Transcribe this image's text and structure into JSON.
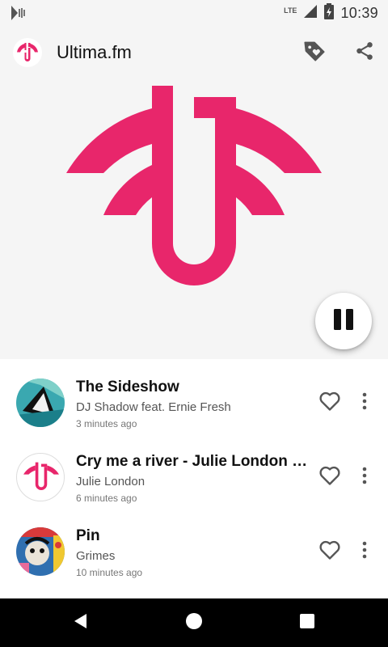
{
  "status_bar": {
    "time": "10:39",
    "network": "LTE",
    "icons": [
      "media-notification-icon",
      "signal-icon",
      "battery-charging-icon"
    ]
  },
  "app_bar": {
    "title": "Ultima.fm",
    "actions": [
      "tag-heart-icon",
      "share-icon"
    ]
  },
  "colors": {
    "brand": "#e8266b",
    "toolbar_bg": "#f5f5f5"
  },
  "player": {
    "state_icon": "pause-icon"
  },
  "tracks": [
    {
      "title": "The Sideshow",
      "artist": "DJ Shadow feat. Ernie Fresh",
      "time": "3 minutes ago"
    },
    {
      "title": "Cry me a river - Julie London 1…",
      "artist": "Julie London",
      "time": "6 minutes ago"
    },
    {
      "title": "Pin",
      "artist": "Grimes",
      "time": "10 minutes ago"
    }
  ],
  "nav_bar": {
    "icons": [
      "back-icon",
      "home-icon",
      "recents-icon"
    ]
  }
}
